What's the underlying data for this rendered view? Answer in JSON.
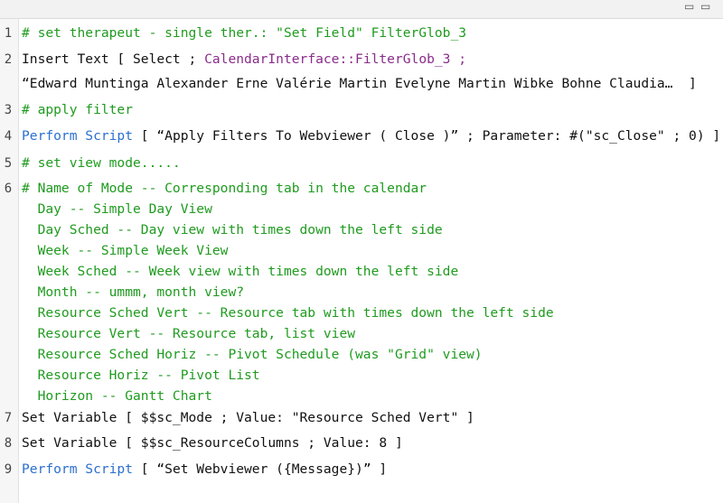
{
  "window": {
    "controls": [
      "minimize-icon",
      "maximize-icon"
    ]
  },
  "script_lines": [
    {
      "num": "1",
      "parts": [
        {
          "text": "# set therapeut - single ther.: \"Set Field\" FilterGlob_3",
          "style": "comment"
        }
      ]
    },
    {
      "num": "2",
      "parts": [
        {
          "text": "Insert Text [ Select ; ",
          "style": "plain"
        },
        {
          "text": "CalendarInterface::FilterGlob_3 ;",
          "style": "purple"
        }
      ]
    },
    {
      "num": "",
      "parts": [
        {
          "text": "“Edward Muntinga Alexander Erne Valérie Martin Evelyne Martin Wibke Bohne Claudia…  ]",
          "style": "plain"
        }
      ]
    },
    {
      "num": "3",
      "parts": [
        {
          "text": "# apply filter",
          "style": "comment"
        }
      ]
    },
    {
      "num": "4",
      "parts": [
        {
          "text": "Perform Script",
          "style": "step-blue"
        },
        {
          "text": " [ “Apply Filters To Webviewer ( Close )” ; Parameter: #(\"sc_Close\" ; 0) ]",
          "style": "plain"
        }
      ]
    },
    {
      "num": "5",
      "parts": [
        {
          "text": "# set view mode.....",
          "style": "comment"
        }
      ]
    },
    {
      "num": "6",
      "parts": [
        {
          "text": "# Name of Mode -- Corresponding tab in the calendar",
          "style": "comment"
        }
      ]
    },
    {
      "num": "",
      "parts": [
        {
          "text": "  Day -- Simple Day View",
          "style": "comment"
        }
      ]
    },
    {
      "num": "",
      "parts": [
        {
          "text": "  Day Sched -- Day view with times down the left side",
          "style": "comment"
        }
      ]
    },
    {
      "num": "",
      "parts": [
        {
          "text": "  Week -- Simple Week View",
          "style": "comment"
        }
      ]
    },
    {
      "num": "",
      "parts": [
        {
          "text": "  Week Sched -- Week view with times down the left side",
          "style": "comment"
        }
      ]
    },
    {
      "num": "",
      "parts": [
        {
          "text": "  Month -- ummm, month view?",
          "style": "comment"
        }
      ]
    },
    {
      "num": "",
      "parts": [
        {
          "text": "  Resource Sched Vert -- Resource tab with times down the left side",
          "style": "comment"
        }
      ]
    },
    {
      "num": "",
      "parts": [
        {
          "text": "  Resource Vert -- Resource tab, list view",
          "style": "comment"
        }
      ]
    },
    {
      "num": "",
      "parts": [
        {
          "text": "  Resource Sched Horiz -- Pivot Schedule (was \"Grid\" view)",
          "style": "comment"
        }
      ]
    },
    {
      "num": "",
      "parts": [
        {
          "text": "  Resource Horiz -- Pivot List",
          "style": "comment"
        }
      ]
    },
    {
      "num": "",
      "parts": [
        {
          "text": "  Horizon -- Gantt Chart",
          "style": "comment"
        }
      ]
    },
    {
      "num": "7",
      "parts": [
        {
          "text": "Set Variable [ $$sc_Mode ; Value: \"Resource Sched Vert\" ]",
          "style": "plain"
        }
      ]
    },
    {
      "num": "8",
      "parts": [
        {
          "text": "Set Variable [ $$sc_ResourceColumns ; Value: 8 ]",
          "style": "plain"
        }
      ]
    },
    {
      "num": "9",
      "parts": [
        {
          "text": "Perform Script",
          "style": "step-blue"
        },
        {
          "text": " [ “Set Webviewer ({Message})” ]",
          "style": "plain"
        }
      ]
    }
  ]
}
